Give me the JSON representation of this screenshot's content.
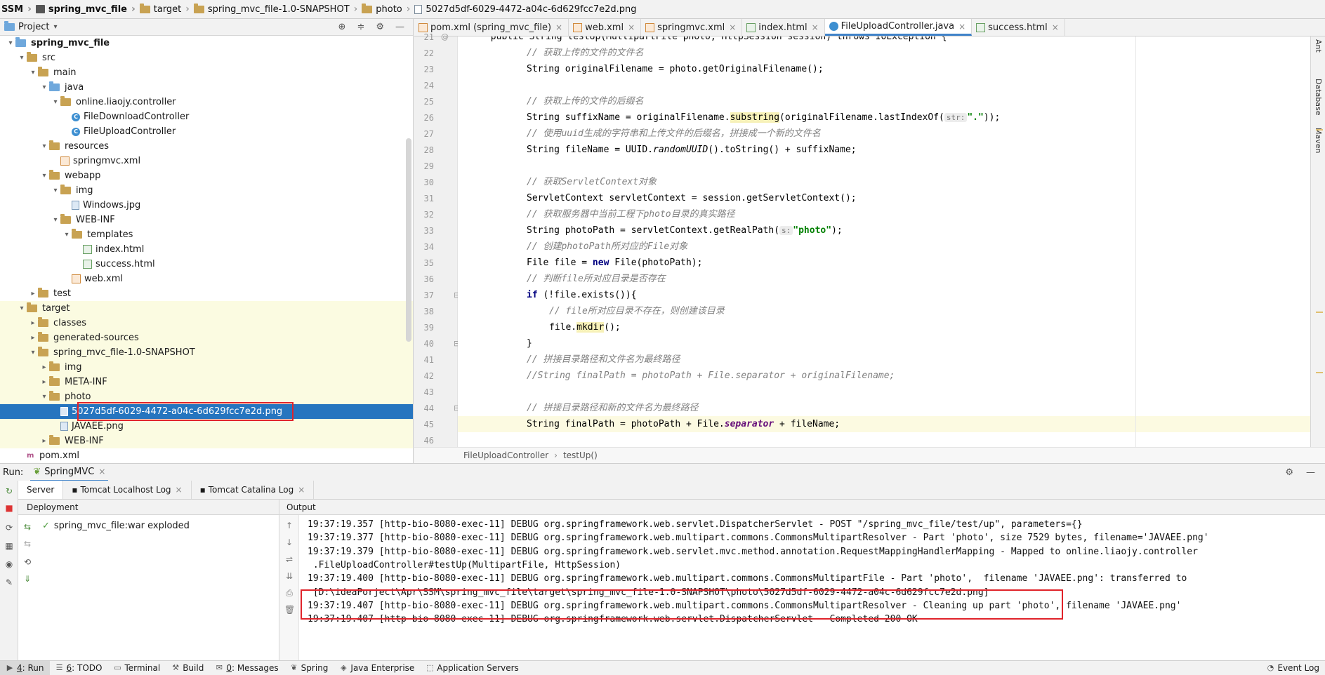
{
  "navbar": {
    "crumbs": [
      "SSM",
      "spring_mvc_file",
      "target",
      "spring_mvc_file-1.0-SNAPSHOT",
      "photo",
      "5027d5df-6029-4472-a04c-6d629fcc7e2d.png"
    ]
  },
  "project": {
    "title": "Project",
    "tree": [
      {
        "label": "spring_mvc_file",
        "depth": 1,
        "arrow": "▾",
        "icon": "module",
        "bold": true
      },
      {
        "label": "src",
        "depth": 2,
        "arrow": "▾",
        "icon": "folder"
      },
      {
        "label": "main",
        "depth": 3,
        "arrow": "▾",
        "icon": "folder"
      },
      {
        "label": "java",
        "depth": 4,
        "arrow": "▾",
        "icon": "folder-blue"
      },
      {
        "label": "online.liaojy.controller",
        "depth": 5,
        "arrow": "▾",
        "icon": "package"
      },
      {
        "label": "FileDownloadController",
        "depth": 6,
        "arrow": "",
        "icon": "class"
      },
      {
        "label": "FileUploadController",
        "depth": 6,
        "arrow": "",
        "icon": "class"
      },
      {
        "label": "resources",
        "depth": 4,
        "arrow": "▾",
        "icon": "folder"
      },
      {
        "label": "springmvc.xml",
        "depth": 5,
        "arrow": "",
        "icon": "xml"
      },
      {
        "label": "webapp",
        "depth": 4,
        "arrow": "▾",
        "icon": "folder"
      },
      {
        "label": "img",
        "depth": 5,
        "arrow": "▾",
        "icon": "folder"
      },
      {
        "label": "Windows.jpg",
        "depth": 6,
        "arrow": "",
        "icon": "image"
      },
      {
        "label": "WEB-INF",
        "depth": 5,
        "arrow": "▾",
        "icon": "folder"
      },
      {
        "label": "templates",
        "depth": 6,
        "arrow": "▾",
        "icon": "folder"
      },
      {
        "label": "index.html",
        "depth": 7,
        "arrow": "",
        "icon": "html"
      },
      {
        "label": "success.html",
        "depth": 7,
        "arrow": "",
        "icon": "html"
      },
      {
        "label": "web.xml",
        "depth": 6,
        "arrow": "",
        "icon": "xml"
      },
      {
        "label": "test",
        "depth": 3,
        "arrow": "▸",
        "icon": "folder"
      },
      {
        "label": "target",
        "depth": 2,
        "arrow": "▾",
        "icon": "folder",
        "target": true
      },
      {
        "label": "classes",
        "depth": 3,
        "arrow": "▸",
        "icon": "folder",
        "target": true
      },
      {
        "label": "generated-sources",
        "depth": 3,
        "arrow": "▸",
        "icon": "folder",
        "target": true
      },
      {
        "label": "spring_mvc_file-1.0-SNAPSHOT",
        "depth": 3,
        "arrow": "▾",
        "icon": "folder",
        "target": true
      },
      {
        "label": "img",
        "depth": 4,
        "arrow": "▸",
        "icon": "folder",
        "target": true
      },
      {
        "label": "META-INF",
        "depth": 4,
        "arrow": "▸",
        "icon": "folder",
        "target": true
      },
      {
        "label": "photo",
        "depth": 4,
        "arrow": "▾",
        "icon": "folder",
        "target": true
      },
      {
        "label": "5027d5df-6029-4472-a04c-6d629fcc7e2d.png",
        "depth": 5,
        "arrow": "",
        "icon": "image",
        "selected": true
      },
      {
        "label": "JAVAEE.png",
        "depth": 5,
        "arrow": "",
        "icon": "image",
        "target": true
      },
      {
        "label": "WEB-INF",
        "depth": 4,
        "arrow": "▸",
        "icon": "folder",
        "target": true
      },
      {
        "label": "pom.xml",
        "depth": 2,
        "arrow": "",
        "icon": "pom"
      }
    ]
  },
  "editor": {
    "tabs": [
      {
        "label": "pom.xml (spring_mvc_file)",
        "icon": "m"
      },
      {
        "label": "web.xml",
        "icon": "m"
      },
      {
        "label": "springmvc.xml",
        "icon": "m"
      },
      {
        "label": "index.html",
        "icon": "h"
      },
      {
        "label": "FileUploadController.java",
        "icon": "c",
        "active": true
      },
      {
        "label": "success.html",
        "icon": "h"
      }
    ],
    "line_numbers": [
      "21",
      "22",
      "23",
      "24",
      "25",
      "26",
      "27",
      "28",
      "29",
      "30",
      "31",
      "32",
      "33",
      "34",
      "35",
      "36",
      "37",
      "38",
      "39",
      "40",
      "41",
      "42",
      "43",
      "44",
      "45",
      "46"
    ],
    "first_line_text": "public String testUp(MultipartFile photo, HttpSession session) throws IOException {",
    "lines": {
      "l22": "// 获取上传的文件的文件名",
      "l23a": "String originalFilename = photo.getOriginalFilename();",
      "l25": "// 获取上传的文件的后缀名",
      "l26a": "String suffixName = originalFilename.",
      "l26b": "substring",
      "l26c": "(originalFilename.lastIndexOf(",
      "l26hint": "str:",
      "l26str": "\".\"",
      "l26d": "));",
      "l27": "// 使用uuid生成的字符串和上传文件的后缀名，拼接成一个新的文件名",
      "l28a": "String fileName = UUID.",
      "l28b": "randomUUID",
      "l28c": "().toString() + suffixName;",
      "l30": "// 获取ServletContext对象",
      "l31": "ServletContext servletContext = session.getServletContext();",
      "l32": "// 获取服务器中当前工程下photo目录的真实路径",
      "l33a": "String photoPath = servletContext.getRealPath(",
      "l33hint": "s:",
      "l33str": "\"photo\"",
      "l33b": ");",
      "l34": "// 创建photoPath所对应的File对象",
      "l35a": "File file = ",
      "l35kw": "new",
      "l35b": " File(photoPath);",
      "l36": "// 判断file所对应目录是否存在",
      "l37kw": "if",
      "l37b": " (!file.exists()){",
      "l38": "// file所对应目录不存在，则创建该目录",
      "l39a": "file.",
      "l39b": "mkdir",
      "l39c": "();",
      "l40": "}",
      "l41": "// 拼接目录路径和文件名为最终路径",
      "l42": "//String finalPath = photoPath + File.separator + originalFilename;",
      "l44": "// 拼接目录路径和新的文件名为最终路径",
      "l45a": "String finalPath = photoPath + File.",
      "l45b": "separator",
      "l45c": " + fileName;"
    },
    "breadcrumb": [
      "FileUploadController",
      "testUp()"
    ]
  },
  "right_strip": [
    "Ant",
    "Database",
    "Maven"
  ],
  "run": {
    "label": "Run:",
    "config": "SpringMVC",
    "tabs": [
      "Server",
      "Tomcat Localhost Log",
      "Tomcat Catalina Log"
    ],
    "deployment_header": "Deployment",
    "deployment_item": "spring_mvc_file:war exploded",
    "output_header": "Output",
    "log": [
      "19:37:19.357 [http-bio-8080-exec-11] DEBUG org.springframework.web.servlet.DispatcherServlet - POST \"/spring_mvc_file/test/up\", parameters={}",
      "19:37:19.377 [http-bio-8080-exec-11] DEBUG org.springframework.web.multipart.commons.CommonsMultipartResolver - Part 'photo', size 7529 bytes, filename='JAVAEE.png'",
      "19:37:19.379 [http-bio-8080-exec-11] DEBUG org.springframework.web.servlet.mvc.method.annotation.RequestMappingHandlerMapping - Mapped to online.liaojy.controller",
      " .FileUploadController#testUp(MultipartFile, HttpSession)",
      "19:37:19.400 [http-bio-8080-exec-11] DEBUG org.springframework.web.multipart.commons.CommonsMultipartFile - Part 'photo',  filename 'JAVAEE.png': transferred to",
      " [D:\\ideaPorject\\Apr\\SSM\\spring_mvc_file\\target\\spring_mvc_file-1.0-SNAPSHOT\\photo\\5027d5df-6029-4472-a04c-6d629fcc7e2d.png]",
      "19:37:19.407 [http-bio-8080-exec-11] DEBUG org.springframework.web.multipart.commons.CommonsMultipartResolver - Cleaning up part 'photo', filename 'JAVAEE.png'",
      "19:37:19.407 [http-bio-8080-exec-11] DEBUG org.springframework.web.servlet.DispatcherServlet - Completed 200 OK"
    ]
  },
  "statusbar": {
    "items": [
      {
        "key": "4",
        "label": ": Run",
        "active": true
      },
      {
        "key": "6",
        "label": ": TODO"
      },
      {
        "key": "",
        "label": "Terminal"
      },
      {
        "key": "",
        "label": "Build"
      },
      {
        "key": "0",
        "label": ": Messages"
      },
      {
        "key": "",
        "label": "Spring"
      },
      {
        "key": "",
        "label": "Java Enterprise"
      },
      {
        "key": "",
        "label": "Application Servers"
      }
    ],
    "event_log": "Event Log"
  },
  "colors": {
    "selection": "#2675bf",
    "highlight_box": "#e0232a",
    "target_bg": "#fbfbe1"
  }
}
